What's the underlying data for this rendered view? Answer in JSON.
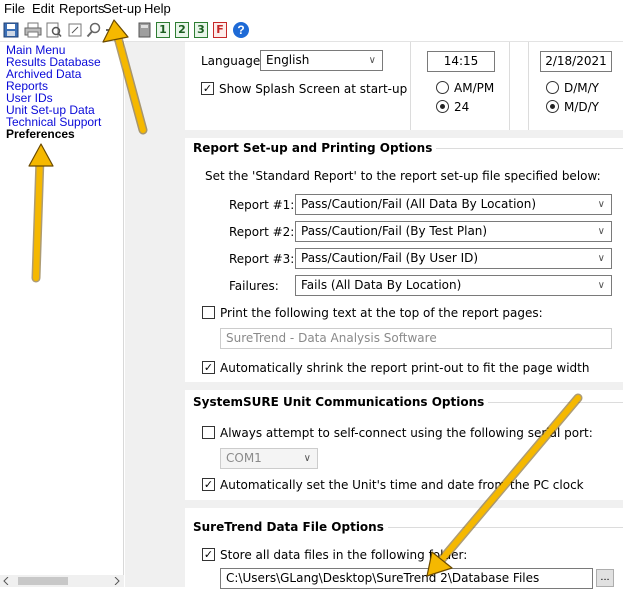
{
  "menu": [
    "File",
    "Edit",
    "Reports",
    "Set-up",
    "Help"
  ],
  "toolbar": {
    "numbered": [
      "1",
      "2",
      "3"
    ],
    "icons": [
      "save-icon",
      "print-icon",
      "print-preview-icon",
      "zoom-icon",
      "search-icon",
      "connect-icon",
      "calculator-icon",
      "report-1-icon",
      "report-2-icon",
      "report-3-icon",
      "fail-report-icon",
      "help-icon"
    ],
    "fail_label": "F",
    "help_label": "?"
  },
  "sidebar": {
    "items": [
      "Main Menu",
      "Results Database",
      "Archived Data",
      "Reports",
      "User IDs",
      "Unit Set-up Data",
      "Technical Support",
      "Preferences"
    ],
    "active": "Preferences"
  },
  "general": {
    "language_label": "Language:",
    "language_value": "English",
    "splash_label": "Show Splash Screen at start-up",
    "splash_checked": true,
    "time_value": "14:15",
    "time_format_options": [
      "AM/PM",
      "24"
    ],
    "time_format_selected": "24",
    "date_value": "2/18/2021",
    "date_format_options": [
      "D/M/Y",
      "M/D/Y"
    ],
    "date_format_selected": "M/D/Y"
  },
  "report": {
    "title": "Report Set-up and Printing Options",
    "intro": "Set the 'Standard Report' to the report set-up file specified below:",
    "rows": [
      {
        "label": "Report #1:",
        "value": "Pass/Caution/Fail (All Data By Location)"
      },
      {
        "label": "Report #2:",
        "value": "Pass/Caution/Fail (By Test Plan)"
      },
      {
        "label": "Report #3:",
        "value": "Pass/Caution/Fail (By User ID)"
      },
      {
        "label": "Failures:",
        "value": "Fails (All Data By Location)"
      }
    ],
    "print_text_label": "Print the following text at the top of the report pages:",
    "print_text_checked": false,
    "print_text_value": "SureTrend - Data Analysis Software",
    "shrink_label": "Automatically shrink the report print-out to fit the page width",
    "shrink_checked": true
  },
  "comms": {
    "title": "SystemSURE Unit Communications Options",
    "connect_label": "Always attempt to self-connect using the following serial port:",
    "connect_checked": false,
    "port_value": "COM1",
    "clock_label": "Automatically set the Unit's time and date from the PC clock",
    "clock_checked": true
  },
  "data_files": {
    "title": "SureTrend Data File Options",
    "store_label": "Store all data files in the following folder:",
    "store_checked": true,
    "folder_value": "C:\\Users\\GLang\\Desktop\\SureTrend 2\\Database Files",
    "browse_label": "..."
  },
  "colors": {
    "link": "#0a0ad8",
    "arrow": "#f5b800",
    "arrow_outline": "#6b4a00",
    "panel_bg": "#f0f0f0"
  }
}
